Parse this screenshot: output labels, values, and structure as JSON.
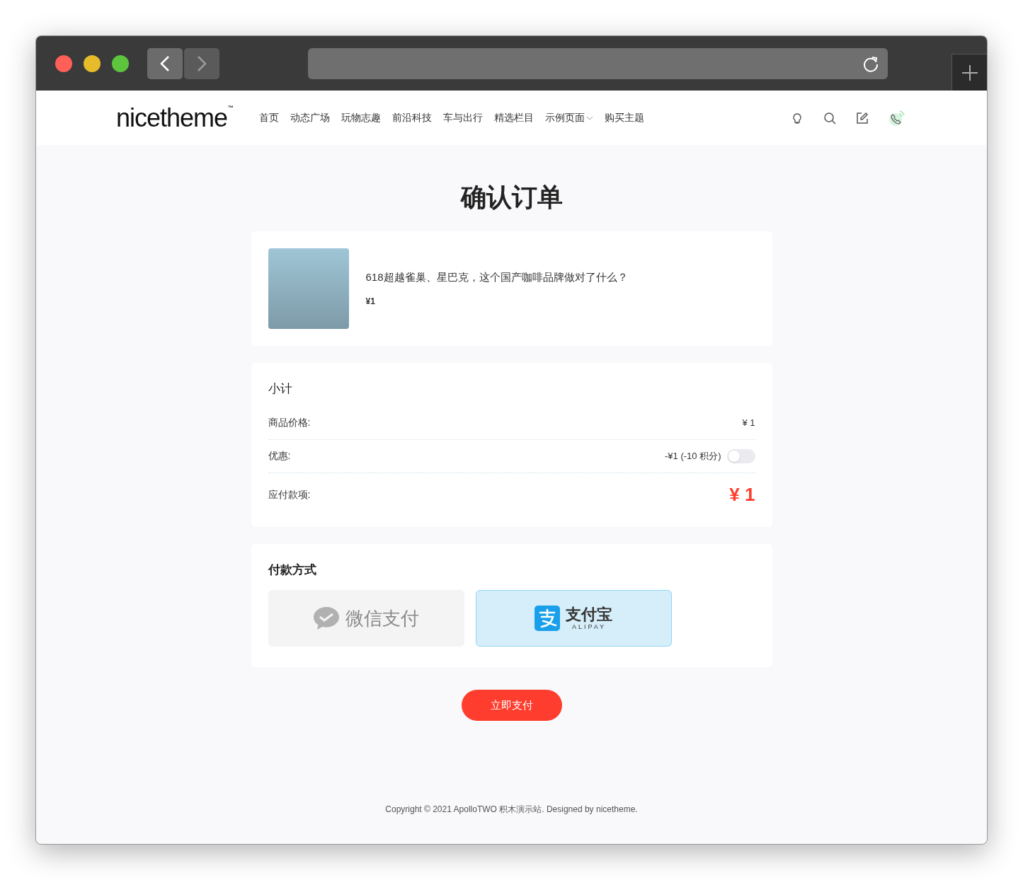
{
  "header": {
    "logo": "nicetheme",
    "logo_mark": "™",
    "nav": [
      {
        "label": "首页",
        "has_menu": false
      },
      {
        "label": "动态广场",
        "has_menu": false
      },
      {
        "label": "玩物志趣",
        "has_menu": false
      },
      {
        "label": "前沿科技",
        "has_menu": false
      },
      {
        "label": "车与出行",
        "has_menu": false
      },
      {
        "label": "精选栏目",
        "has_menu": false
      },
      {
        "label": "示例页面",
        "has_menu": true
      },
      {
        "label": "购买主题",
        "has_menu": false
      }
    ]
  },
  "title": "确认订单",
  "product": {
    "name": "618超越雀巢、星巴克，这个国产咖啡品牌做对了什么？",
    "price": "¥1"
  },
  "subtotal": {
    "heading": "小计",
    "rows": [
      {
        "kind": "plain",
        "label": "商品价格:",
        "value": "¥ 1"
      },
      {
        "kind": "toggle",
        "label": "优惠:",
        "value": "-¥1 (-10 积分)",
        "on": false
      },
      {
        "kind": "total",
        "label": "应付款项:",
        "value": "¥ 1"
      }
    ]
  },
  "payment": {
    "heading": "付款方式",
    "methods": [
      {
        "kind": "wechat",
        "label": "微信支付",
        "selected": false
      },
      {
        "kind": "alipay",
        "label": "支付宝",
        "sublabel": "ALIPAY",
        "selected": true
      }
    ]
  },
  "pay_button": "立即支付",
  "footer": "Copyright © 2021 ApolloTWO 积木演示站. Designed by nicetheme."
}
